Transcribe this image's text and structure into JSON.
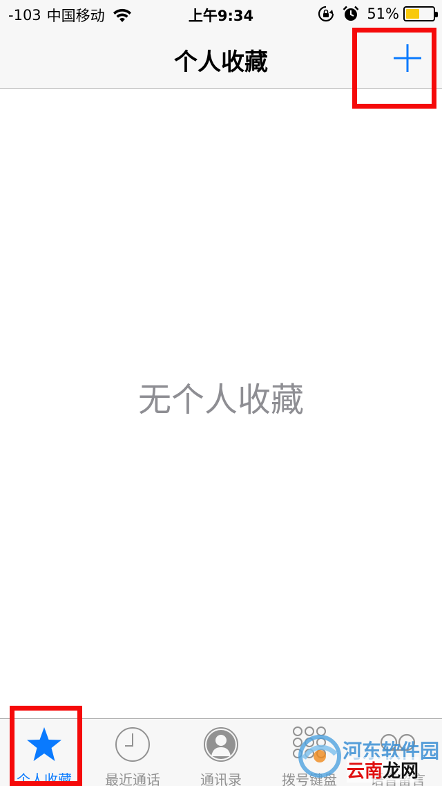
{
  "status_bar": {
    "signal": "-103",
    "carrier": "中国移动",
    "time": "上午9:34",
    "battery_percent": "51%",
    "battery_level": 0.51,
    "battery_color": "#f8c90d"
  },
  "nav": {
    "title": "个人收藏",
    "add_icon": "plus-icon"
  },
  "main": {
    "empty_message": "无个人收藏"
  },
  "tabs": [
    {
      "label": "个人收藏",
      "icon": "star-icon",
      "active": true
    },
    {
      "label": "最近通话",
      "icon": "clock-icon",
      "active": false
    },
    {
      "label": "通讯录",
      "icon": "contact-icon",
      "active": false
    },
    {
      "label": "拨号键盘",
      "icon": "keypad-icon",
      "active": false
    },
    {
      "label": "语音留言",
      "icon": "voicemail-icon",
      "active": false
    }
  ],
  "watermark": {
    "line1": "河东软件园",
    "line2_red": "云南",
    "line2_rest": "龙网"
  },
  "colors": {
    "accent": "#0a7afe",
    "highlight": "#f50a0a",
    "inactive": "#929292",
    "empty_text": "#8e8e93"
  }
}
